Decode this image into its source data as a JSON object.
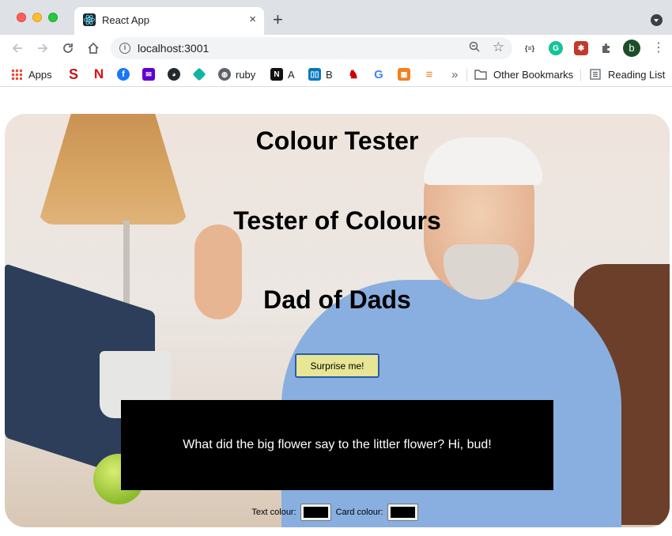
{
  "browser": {
    "tab_title": "React App",
    "tab_close": "×",
    "new_tab": "+",
    "url": "localhost:3001",
    "profile_initial": "b",
    "bookmarks": [
      {
        "label": "Apps",
        "icon": "apps-grid-icon"
      },
      {
        "label": "",
        "icon": "s-logo-icon",
        "color": "#c4161c"
      },
      {
        "label": "",
        "icon": "netflix-icon",
        "color": "#e50914"
      },
      {
        "label": "",
        "icon": "facebook-icon",
        "color": "#1877f2"
      },
      {
        "label": "",
        "icon": "mail-icon",
        "color": "#5f01d1"
      },
      {
        "label": "",
        "icon": "github-icon",
        "color": "#24292e"
      },
      {
        "label": "",
        "icon": "diamond-icon",
        "color": "#12b5a3"
      },
      {
        "label": "ruby",
        "icon": "globe-icon"
      },
      {
        "label": "A",
        "icon": "notion-icon"
      },
      {
        "label": "B",
        "icon": "trello-icon",
        "color": "#0079bf"
      },
      {
        "label": "",
        "icon": "rails-icon",
        "color": "#cc0000"
      },
      {
        "label": "",
        "icon": "google-icon",
        "color": "#4285f4"
      },
      {
        "label": "",
        "icon": "boxes-icon",
        "color": "#f38020"
      },
      {
        "label": "",
        "icon": "stackoverflow-icon",
        "color": "#f48024"
      }
    ],
    "overflow": "»",
    "other_bookmarks": "Other Bookmarks",
    "reading_list": "Reading List"
  },
  "page": {
    "heading_1": "Colour Tester",
    "heading_2": "Tester of Colours",
    "heading_3": "Dad of Dads",
    "button_label": "Surprise me!",
    "button_color": "#e6e694",
    "card_text": "What did the big flower say to the littler flower? Hi, bud!",
    "card_color": "#000000",
    "text_color": "#ffffff",
    "text_colour_label": "Text colour:",
    "card_colour_label": "Card colour:",
    "text_colour_value": "#000000",
    "card_colour_value": "#000000"
  }
}
